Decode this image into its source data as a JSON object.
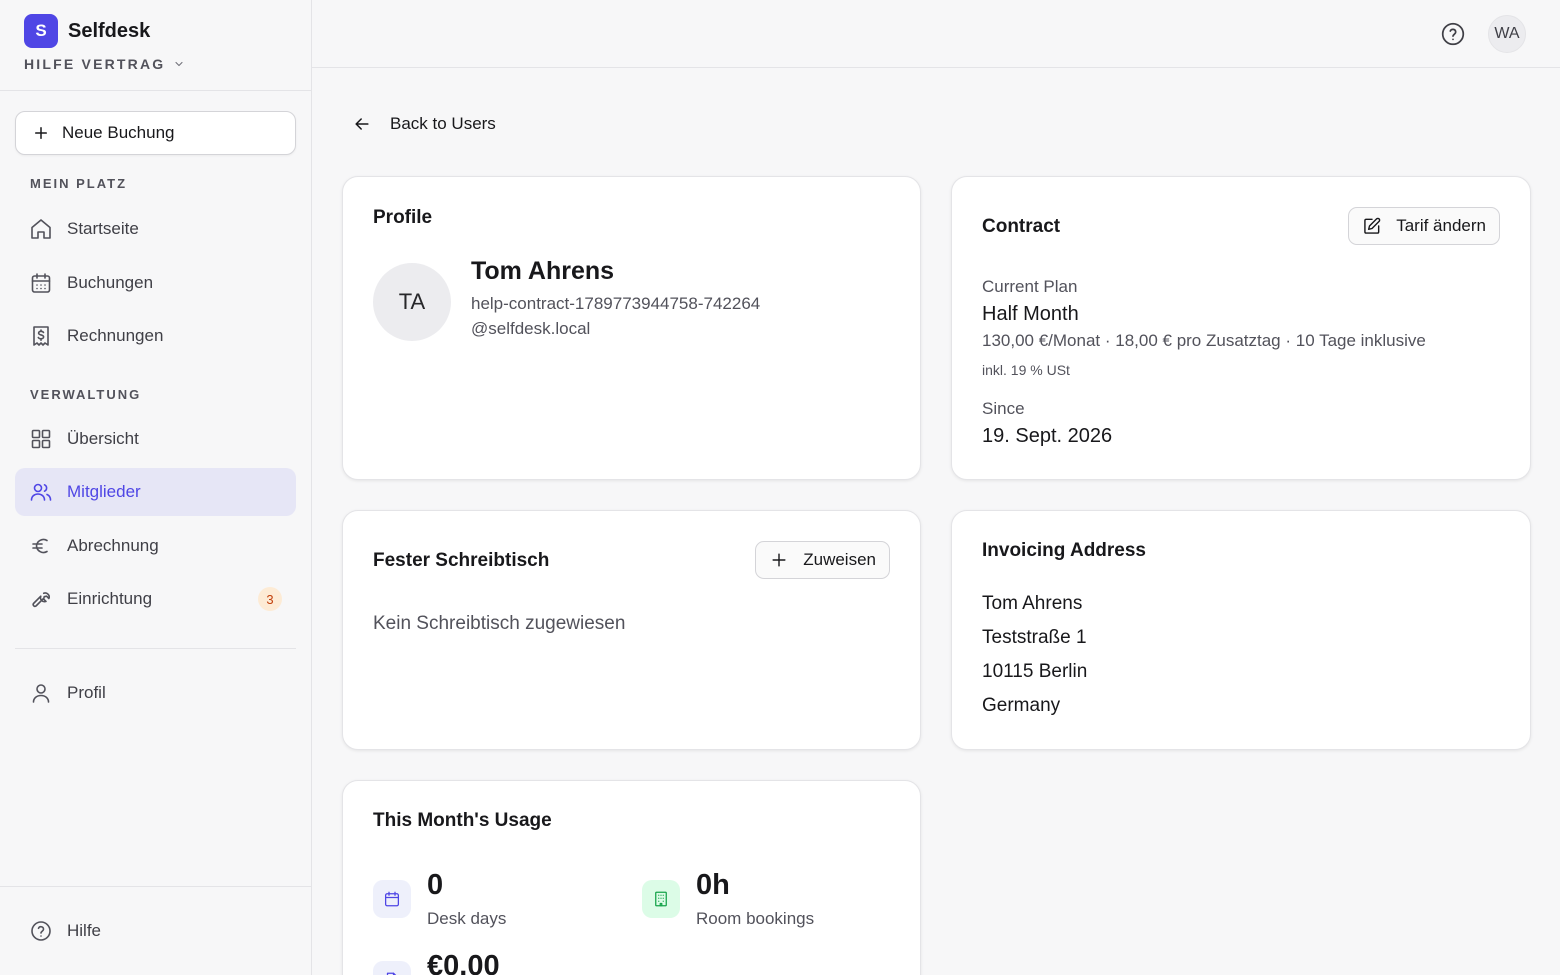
{
  "app": {
    "name": "Selfdesk",
    "logo_letter": "S",
    "workspace": "HILFE VERTRAG"
  },
  "sidebar": {
    "new_booking": "Neue Buchung",
    "section_my_place": "MEIN PLATZ",
    "section_admin": "VERWALTUNG",
    "items": [
      {
        "label": "Startseite",
        "icon": "home-icon"
      },
      {
        "label": "Buchungen",
        "icon": "calendar-icon"
      },
      {
        "label": "Rechnungen",
        "icon": "receipt-icon"
      },
      {
        "label": "Übersicht",
        "icon": "grid-icon"
      },
      {
        "label": "Mitglieder",
        "icon": "users-icon",
        "active": true
      },
      {
        "label": "Abrechnung",
        "icon": "euro-icon"
      },
      {
        "label": "Einrichtung",
        "icon": "wrench-icon",
        "badge": "3"
      },
      {
        "label": "Profil",
        "icon": "user-icon"
      },
      {
        "label": "Hilfe",
        "icon": "help-circle-icon"
      }
    ]
  },
  "topbar": {
    "avatar_initials": "WA"
  },
  "main": {
    "back_label": "Back to Users",
    "profile": {
      "title": "Profile",
      "initials": "TA",
      "name": "Tom Ahrens",
      "email": "help-contract-1789773944758-742264@selfdesk.local"
    },
    "contract": {
      "title": "Contract",
      "change_button": "Tarif ändern",
      "current_plan_label": "Current Plan",
      "plan_name": "Half Month",
      "plan_details": "130,00 €/Monat · 18,00 € pro Zusatztag · 10 Tage inklusive",
      "vat_note": "inkl. 19 % USt",
      "since_label": "Since",
      "since_value": "19. Sept. 2026"
    },
    "desk": {
      "title": "Fester Schreibtisch",
      "assign_button": "Zuweisen",
      "empty": "Kein Schreibtisch zugewiesen"
    },
    "invoicing": {
      "title": "Invoicing Address",
      "lines": [
        "Tom Ahrens",
        "Teststraße 1",
        "10115 Berlin",
        "Germany"
      ]
    },
    "usage": {
      "title": "This Month's Usage",
      "stats": [
        {
          "value": "0",
          "label": "Desk days",
          "icon": "calendar-icon"
        },
        {
          "value": "0h",
          "label": "Room bookings",
          "icon": "building-icon"
        },
        {
          "value": "€0.00",
          "label": "",
          "icon": "document-icon"
        }
      ]
    }
  },
  "colors": {
    "accent": "#4f46e5",
    "active_bg": "#e6e6f6",
    "badge_bg": "#fdebd5",
    "badge_fg": "#c2410c",
    "room_icon_bg": "#dcfce7",
    "room_icon_fg": "#16a34a"
  }
}
